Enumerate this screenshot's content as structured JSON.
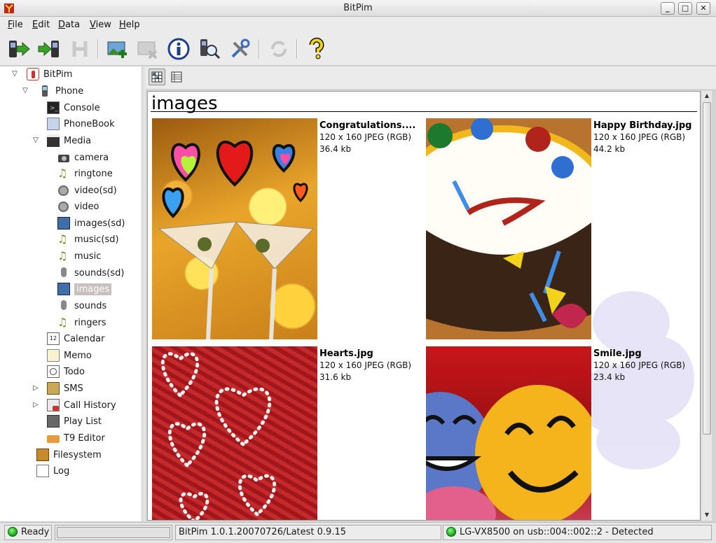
{
  "window": {
    "title": "BitPim"
  },
  "menu": {
    "items": [
      {
        "label": "File",
        "accel": "F",
        "rest": "ile"
      },
      {
        "label": "Edit",
        "accel": "E",
        "rest": "dit"
      },
      {
        "label": "Data",
        "accel": "D",
        "rest": "ata"
      },
      {
        "label": "View",
        "accel": "V",
        "rest": "iew"
      },
      {
        "label": "Help",
        "accel": "H",
        "rest": "elp"
      }
    ]
  },
  "toolbar": {
    "buttons": [
      {
        "name": "get-phone-data-icon"
      },
      {
        "name": "send-phone-data-icon"
      },
      {
        "name": "history-icon"
      },
      {
        "name": "add-image-icon"
      },
      {
        "name": "delete-image-icon"
      },
      {
        "name": "info-icon"
      },
      {
        "name": "detect-phone-icon"
      },
      {
        "name": "settings-icon"
      },
      {
        "name": "refresh-icon"
      },
      {
        "name": "help-icon"
      }
    ]
  },
  "tree": {
    "root": "BitPim",
    "phone": "Phone",
    "items": [
      {
        "label": "Console"
      },
      {
        "label": "PhoneBook"
      },
      {
        "label": "Media"
      },
      {
        "label": "camera"
      },
      {
        "label": "ringtone"
      },
      {
        "label": "video(sd)"
      },
      {
        "label": "video"
      },
      {
        "label": "images(sd)"
      },
      {
        "label": "music(sd)"
      },
      {
        "label": "music"
      },
      {
        "label": "sounds(sd)"
      },
      {
        "label": "images"
      },
      {
        "label": "sounds"
      },
      {
        "label": "ringers"
      },
      {
        "label": "Calendar"
      },
      {
        "label": "Memo"
      },
      {
        "label": "Todo"
      },
      {
        "label": "SMS"
      },
      {
        "label": "Call History"
      },
      {
        "label": "Play List"
      },
      {
        "label": "T9 Editor"
      },
      {
        "label": "Filesystem"
      },
      {
        "label": "Log"
      }
    ],
    "selected": "images"
  },
  "content": {
    "section_title": "images",
    "cards": [
      {
        "name": "Congratulations....",
        "dims": "120 x 160 JPEG (RGB)",
        "size": "36.4 kb"
      },
      {
        "name": "Happy Birthday.jpg",
        "dims": "120 x 160 JPEG (RGB)",
        "size": "44.2 kb"
      },
      {
        "name": "Hearts.jpg",
        "dims": "120 x 160 JPEG (RGB)",
        "size": "31.6 kb"
      },
      {
        "name": "Smile.jpg",
        "dims": "120 x 160 JPEG (RGB)",
        "size": "23.4 kb"
      }
    ]
  },
  "status": {
    "state": "Ready",
    "version": "BitPim 1.0.1.20070726/Latest 0.9.15",
    "device": "LG-VX8500 on usb::004::002::2 - Detected"
  },
  "colors": {
    "led": "#16b516",
    "selection": "#c8c0bc"
  }
}
